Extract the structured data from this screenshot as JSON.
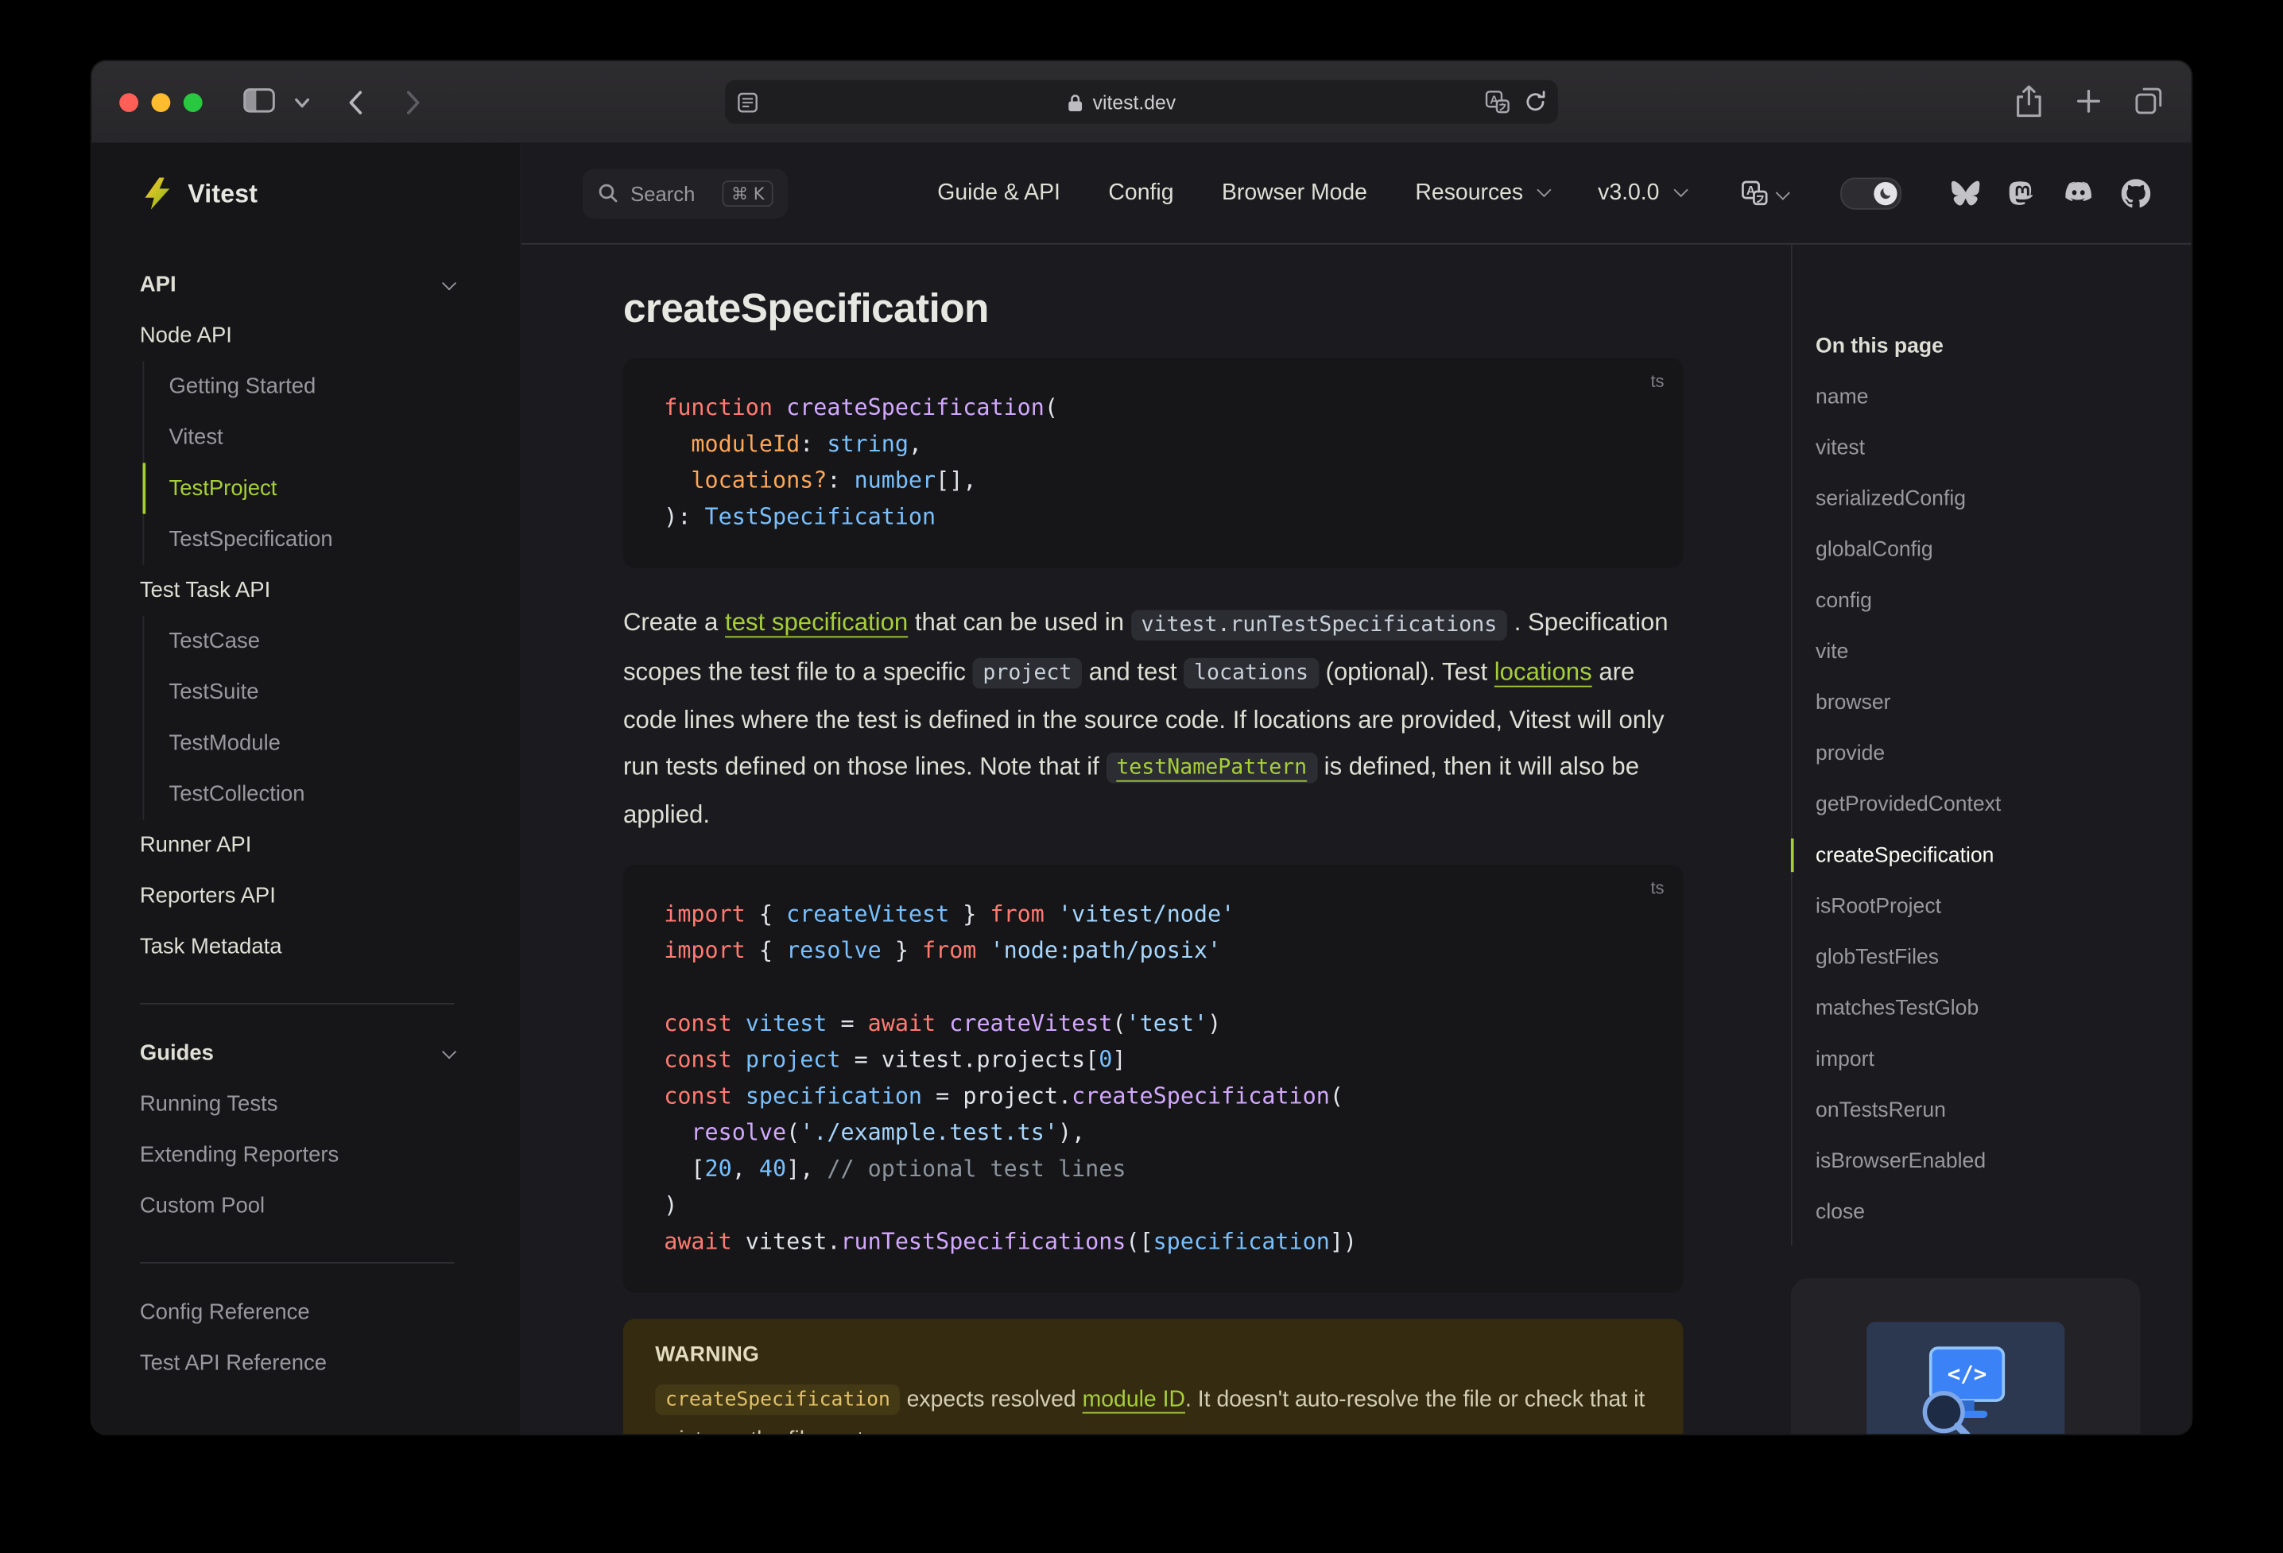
{
  "window": {
    "url": "vitest.dev",
    "traffic_lights": [
      "close",
      "minimize",
      "zoom"
    ]
  },
  "icons": {
    "titlebar": [
      "sidebar-toggle",
      "tab-chevron",
      "back",
      "forward",
      "page-settings",
      "lock",
      "translate",
      "reload",
      "share",
      "new-tab",
      "tab-overview"
    ],
    "navbar": [
      "search",
      "language",
      "theme-toggle-moon",
      "bluesky",
      "mastodon",
      "discord",
      "github"
    ],
    "logo": "vitest-lightning-bolt",
    "sponsor": "monitor-code-magnifier"
  },
  "topnav": {
    "search": {
      "label": "Search",
      "shortcut": "⌘ K"
    },
    "items": [
      {
        "label": "Guide & API",
        "dropdown": false
      },
      {
        "label": "Config",
        "dropdown": false
      },
      {
        "label": "Browser Mode",
        "dropdown": false
      },
      {
        "label": "Resources",
        "dropdown": true
      },
      {
        "label": "v3.0.0",
        "dropdown": true
      }
    ]
  },
  "sidebar": {
    "brand": "Vitest",
    "sections": [
      {
        "title": "API",
        "entries": [
          {
            "label": "Node API",
            "kind": "group"
          },
          {
            "label": "Getting Started",
            "kind": "sub"
          },
          {
            "label": "Vitest",
            "kind": "sub"
          },
          {
            "label": "TestProject",
            "kind": "sub",
            "active": true
          },
          {
            "label": "TestSpecification",
            "kind": "sub"
          },
          {
            "label": "Test Task API",
            "kind": "group"
          },
          {
            "label": "TestCase",
            "kind": "sub"
          },
          {
            "label": "TestSuite",
            "kind": "sub"
          },
          {
            "label": "TestModule",
            "kind": "sub"
          },
          {
            "label": "TestCollection",
            "kind": "sub"
          },
          {
            "label": "Runner API",
            "kind": "group"
          },
          {
            "label": "Reporters API",
            "kind": "group"
          },
          {
            "label": "Task Metadata",
            "kind": "group"
          }
        ]
      },
      {
        "title": "Guides",
        "entries": [
          {
            "label": "Running Tests",
            "kind": "item"
          },
          {
            "label": "Extending Reporters",
            "kind": "item"
          },
          {
            "label": "Custom Pool",
            "kind": "item"
          }
        ]
      },
      {
        "entries": [
          {
            "label": "Config Reference",
            "kind": "item"
          },
          {
            "label": "Test API Reference",
            "kind": "item"
          }
        ]
      }
    ]
  },
  "content": {
    "title": "createSpecification",
    "code1": {
      "lang": "ts",
      "lines": [
        [
          [
            "kw",
            "function "
          ],
          [
            "fn",
            "createSpecification"
          ],
          [
            "pl",
            "("
          ]
        ],
        [
          [
            "pl",
            "  "
          ],
          [
            "prm",
            "moduleId"
          ],
          [
            "pl",
            ": "
          ],
          [
            "typ",
            "string"
          ],
          [
            "pl",
            ","
          ]
        ],
        [
          [
            "pl",
            "  "
          ],
          [
            "prm",
            "locations?"
          ],
          [
            "pl",
            ": "
          ],
          [
            "typ",
            "number"
          ],
          [
            "pl",
            "[],"
          ]
        ],
        [
          [
            "pl",
            "): "
          ],
          [
            "typ",
            "TestSpecification"
          ]
        ]
      ]
    },
    "paragraph": [
      {
        "t": "Create a ",
        "s": "text"
      },
      {
        "t": "test specification",
        "s": "link"
      },
      {
        "t": " that can be used in ",
        "s": "text"
      },
      {
        "t": "vitest.runTestSpecifications",
        "s": "code"
      },
      {
        "t": " . Specification scopes the test file to a specific ",
        "s": "text"
      },
      {
        "t": "project",
        "s": "code"
      },
      {
        "t": " and test ",
        "s": "text"
      },
      {
        "t": "locations",
        "s": "code"
      },
      {
        "t": " (optional). Test ",
        "s": "text"
      },
      {
        "t": "locations",
        "s": "link"
      },
      {
        "t": " are code lines where the test is defined in the source code. If locations are provided, Vitest will only run tests defined on those lines. Note that if ",
        "s": "text"
      },
      {
        "t": "testNamePattern",
        "s": "codelink"
      },
      {
        "t": " is defined, then it will also be applied.",
        "s": "text"
      }
    ],
    "code2": {
      "lang": "ts",
      "lines": [
        [
          [
            "kw",
            "import"
          ],
          [
            "pl",
            " { "
          ],
          [
            "var",
            "createVitest"
          ],
          [
            "pl",
            " } "
          ],
          [
            "kw",
            "from"
          ],
          [
            "pl",
            " "
          ],
          [
            "str",
            "'vitest/node'"
          ]
        ],
        [
          [
            "kw",
            "import"
          ],
          [
            "pl",
            " { "
          ],
          [
            "var",
            "resolve"
          ],
          [
            "pl",
            " } "
          ],
          [
            "kw",
            "from"
          ],
          [
            "pl",
            " "
          ],
          [
            "str",
            "'node:path/posix'"
          ]
        ],
        [],
        [
          [
            "kw",
            "const"
          ],
          [
            "pl",
            " "
          ],
          [
            "var",
            "vitest"
          ],
          [
            "pl",
            " = "
          ],
          [
            "kw",
            "await"
          ],
          [
            "pl",
            " "
          ],
          [
            "fn",
            "createVitest"
          ],
          [
            "pl",
            "("
          ],
          [
            "str",
            "'test'"
          ],
          [
            "pl",
            ")"
          ]
        ],
        [
          [
            "kw",
            "const"
          ],
          [
            "pl",
            " "
          ],
          [
            "var",
            "project"
          ],
          [
            "pl",
            " = vitest.projects["
          ],
          [
            "var",
            "0"
          ],
          [
            "pl",
            "]"
          ]
        ],
        [
          [
            "kw",
            "const"
          ],
          [
            "pl",
            " "
          ],
          [
            "var",
            "specification"
          ],
          [
            "pl",
            " = project."
          ],
          [
            "fn",
            "createSpecification"
          ],
          [
            "pl",
            "("
          ]
        ],
        [
          [
            "pl",
            "  "
          ],
          [
            "fn",
            "resolve"
          ],
          [
            "pl",
            "("
          ],
          [
            "str",
            "'./example.test.ts'"
          ],
          [
            "pl",
            "),"
          ]
        ],
        [
          [
            "pl",
            "  ["
          ],
          [
            "var",
            "20"
          ],
          [
            "pl",
            ", "
          ],
          [
            "var",
            "40"
          ],
          [
            "pl",
            "], "
          ],
          [
            "cm",
            "// optional test lines"
          ]
        ],
        [
          [
            "pl",
            ")"
          ]
        ],
        [
          [
            "kw",
            "await"
          ],
          [
            "pl",
            " vitest."
          ],
          [
            "fn",
            "runTestSpecifications"
          ],
          [
            "pl",
            "(["
          ],
          [
            "var",
            "specification"
          ],
          [
            "pl",
            "])"
          ]
        ]
      ]
    },
    "warning": {
      "title": "WARNING",
      "body": [
        {
          "t": "createSpecification",
          "s": "code"
        },
        {
          "t": " expects resolved ",
          "s": "text"
        },
        {
          "t": "module ID",
          "s": "link"
        },
        {
          "t": ". It doesn't auto-resolve the file or check that it exists on the file system.",
          "s": "text"
        }
      ]
    }
  },
  "outline": {
    "title": "On this page",
    "items": [
      {
        "label": "name"
      },
      {
        "label": "vitest"
      },
      {
        "label": "serializedConfig"
      },
      {
        "label": "globalConfig"
      },
      {
        "label": "config"
      },
      {
        "label": "vite"
      },
      {
        "label": "browser"
      },
      {
        "label": "provide"
      },
      {
        "label": "getProvidedContext"
      },
      {
        "label": "createSpecification",
        "active": true
      },
      {
        "label": "isRootProject"
      },
      {
        "label": "globTestFiles"
      },
      {
        "label": "matchesTestGlob"
      },
      {
        "label": "import"
      },
      {
        "label": "onTestsRerun"
      },
      {
        "label": "isBrowserEnabled"
      },
      {
        "label": "close"
      }
    ]
  }
}
